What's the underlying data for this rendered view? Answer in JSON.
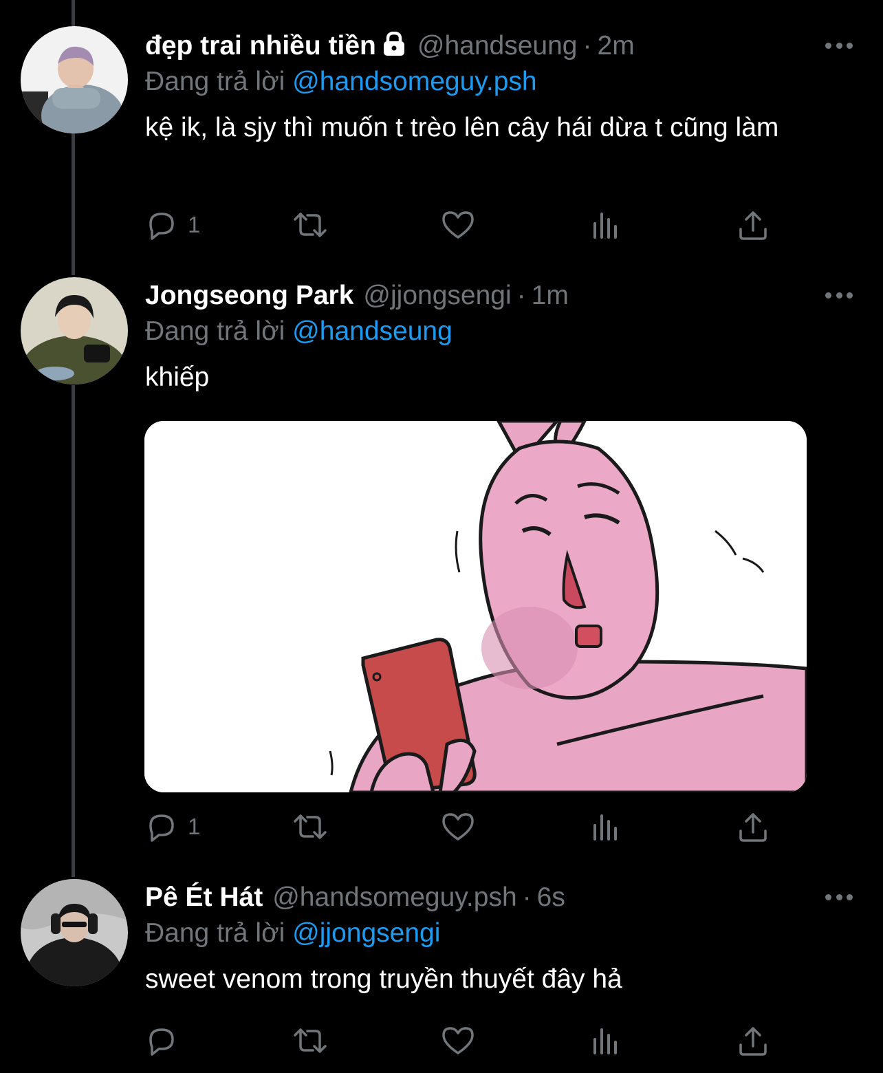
{
  "reply_prefix": "Đang trả lời",
  "tweets": [
    {
      "name": "đẹp trai nhiều tiền",
      "locked": true,
      "handle": "@handseung",
      "time": "2m",
      "reply_to": "@handsomeguy.psh",
      "text": "kệ ik, là sjy thì muốn t trèo lên cây hái dừa t cũng làm",
      "replies": "1",
      "has_media": false
    },
    {
      "name": "Jongseong Park",
      "locked": false,
      "handle": "@jjongsengi",
      "time": "1m",
      "reply_to": "@handseung",
      "text": "khiếp",
      "replies": "1",
      "has_media": true
    },
    {
      "name": "Pê Ét Hát",
      "locked": false,
      "handle": "@handsomeguy.psh",
      "time": "6s",
      "reply_to": "@jjongsengi",
      "text": "sweet venom trong truyền thuyết đây hả",
      "replies": "",
      "has_media": false
    }
  ],
  "separator": "·",
  "colors": {
    "background": "#000000",
    "text": "#ffffff",
    "secondary": "#71767b",
    "link": "#1d9bf0",
    "bunny": "#e8a5c4"
  }
}
